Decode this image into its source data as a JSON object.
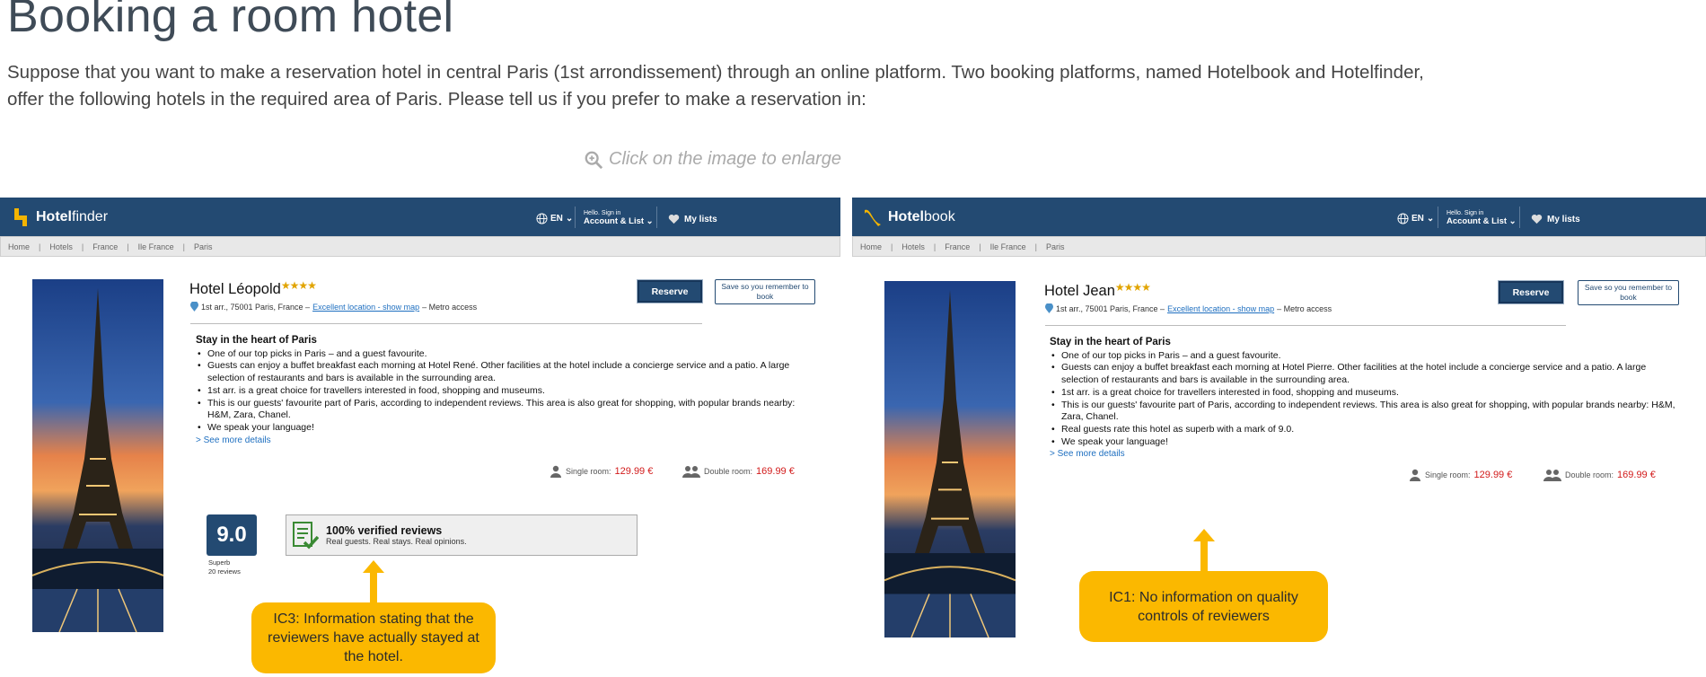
{
  "title": "Booking a room hotel",
  "intro": "Suppose that you want to make a reservation hotel in central Paris (1st arrondissement) through an online platform. Two booking platforms, named Hotelbook and Hotelfinder, offer the following hotels in the required area of Paris. Please tell us if you prefer to make a reservation in:",
  "enlarge_label": "Click on the image to enlarge",
  "nav": {
    "lang": "EN",
    "hello": "Hello. Sign in",
    "account": "Account & List",
    "mylists": "My lists"
  },
  "breadcrumbs": [
    "Home",
    "Hotels",
    "France",
    "Ile France",
    "Paris"
  ],
  "colors": {
    "nav": "#234a72",
    "accent_yellow": "#fbb800",
    "price_red": "#d21b1b",
    "link_blue": "#1e6fc0"
  },
  "panels": [
    {
      "brand_bold": "Hotel",
      "brand_light": "finder",
      "hotel_name": "Hotel Léopold",
      "stars": "★★★★",
      "address": "1st arr., 75001 Paris, France –",
      "location_link": "Excellent location - show map",
      "metro": "– Metro access",
      "reserve": "Reserve",
      "save": "Save so you remember to book",
      "heading": "Stay in the heart of Paris",
      "bullets": [
        "One of our top picks in Paris – and a guest favourite.",
        "Guests can enjoy a buffet breakfast each morning at Hotel René. Other facilities at the hotel include a concierge service and a patio. A large selection of restaurants and bars is available in the surrounding area.",
        "1st arr. is a great choice for travellers interested in food, shopping and museums.",
        "This is our guests' favourite part of Paris, according to independent reviews. This area is also great for shopping, with popular brands nearby: H&M, Zara, Chanel.",
        "We speak your language!"
      ],
      "see_more": "> See more details",
      "single_label": "Single room:",
      "single_price": "129.99 €",
      "double_label": "Double room:",
      "double_price": "169.99 €",
      "score": "9.0",
      "score_word": "Superb",
      "score_count": "20 reviews",
      "verified_title": "100% verified reviews",
      "verified_sub": "Real guests. Real stays. Real opinions.",
      "callout": "IC3: Information  stating that the reviewers have actually stayed at the hotel."
    },
    {
      "brand_bold": "Hotel",
      "brand_light": "book",
      "hotel_name": "Hotel Jean",
      "stars": "★★★★",
      "address": "1st arr., 75001 Paris, France –",
      "location_link": "Excellent location - show map",
      "metro": "– Metro access",
      "reserve": "Reserve",
      "save": "Save so you remember to book",
      "heading": "Stay in the heart of Paris",
      "bullets": [
        "One of our top picks in Paris – and a guest favourite.",
        "Guests can enjoy a buffet breakfast each morning at Hotel Pierre. Other facilities at the hotel include a concierge service and a patio. A large selection of restaurants and bars is available in the surrounding area.",
        "1st arr. is a great choice for travellers interested in food, shopping and museums.",
        "This is our guests' favourite part of Paris, according to independent reviews. This area is also great for shopping, with popular brands nearby: H&M, Zara, Chanel.",
        "Real guests rate this hotel as superb with a mark of 9.0.",
        "We speak your language!"
      ],
      "see_more": "> See more details",
      "single_label": "Single room:",
      "single_price": "129.99 €",
      "double_label": "Double room:",
      "double_price": "169.99 €",
      "callout": "IC1: No information on quality controls of reviewers"
    }
  ]
}
